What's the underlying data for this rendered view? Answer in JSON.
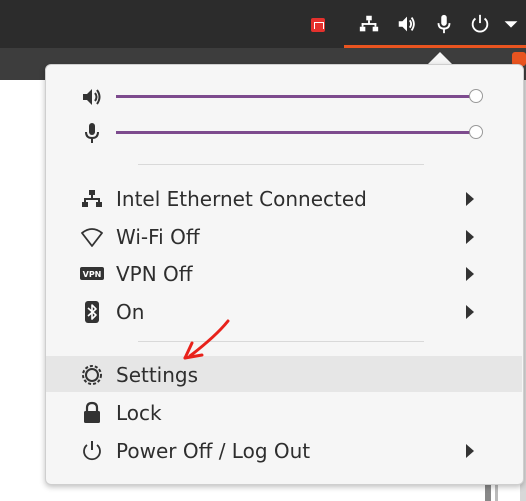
{
  "topbar": {
    "icons": [
      "app-indicator-icon",
      "network-icon",
      "volume-icon",
      "microphone-icon",
      "power-icon",
      "dropdown-arrow-icon"
    ]
  },
  "menu": {
    "volume_slider": {
      "icon": "volume-icon",
      "level": 1.0
    },
    "mic_slider": {
      "icon": "microphone-icon",
      "level": 1.0
    },
    "items": [
      {
        "icon": "network-wired-icon",
        "label": "Intel Ethernet Connected",
        "submenu": true
      },
      {
        "icon": "wifi-icon",
        "label": "Wi-Fi Off",
        "submenu": true
      },
      {
        "icon": "vpn-icon",
        "label": "VPN Off",
        "submenu": true
      },
      {
        "icon": "bluetooth-icon",
        "label": "On",
        "submenu": true
      },
      {
        "icon": "gear-icon",
        "label": "Settings",
        "submenu": false,
        "highlighted": true
      },
      {
        "icon": "lock-icon",
        "label": "Lock",
        "submenu": false
      },
      {
        "icon": "power-icon",
        "label": "Power Off / Log Out",
        "submenu": true
      }
    ]
  },
  "colors": {
    "topbar_bg": "#2c2c2c",
    "accent_orange": "#e95420",
    "slider_purple": "#7d4b8e",
    "menu_bg": "#f6f6f6",
    "hover_bg": "#e6e6e6",
    "annotation_red": "#e8221b"
  }
}
